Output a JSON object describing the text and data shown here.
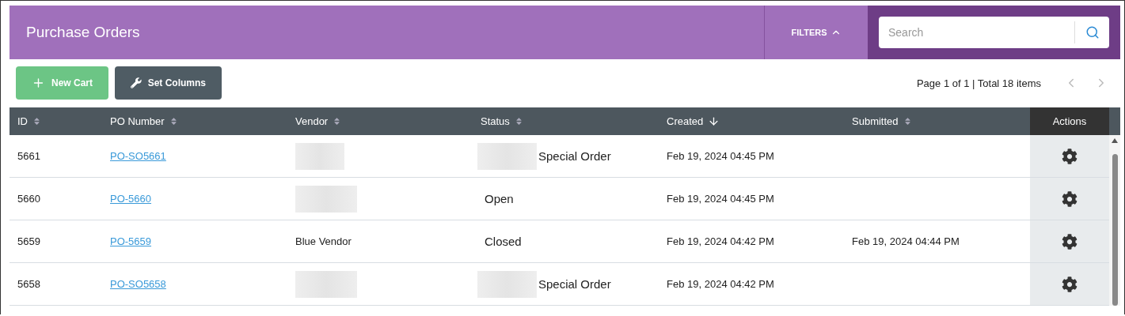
{
  "header": {
    "title": "Purchase Orders",
    "filters": {
      "label": "FILTERS",
      "expanded": true
    },
    "search": {
      "placeholder": "Search"
    }
  },
  "toolbar": {
    "buttons": [
      {
        "label": "New Cart",
        "kind": "new"
      },
      {
        "label": "Set Columns",
        "kind": "columns"
      }
    ],
    "pagination": {
      "text": "Page 1 of 1 | Total 18 items",
      "prev_disabled": true,
      "next_disabled": true
    }
  },
  "table": {
    "columns": [
      {
        "label": "ID",
        "sortable": true,
        "sorted_desc": false
      },
      {
        "label": "PO Number",
        "sortable": true,
        "sorted_desc": false
      },
      {
        "label": "Vendor",
        "sortable": true,
        "sorted_desc": false
      },
      {
        "label": "Status",
        "sortable": true,
        "sorted_desc": false
      },
      {
        "label": "Created",
        "sortable": true,
        "sorted_desc": true
      },
      {
        "label": "Submitted",
        "sortable": true,
        "sorted_desc": false
      },
      {
        "label": "Actions",
        "kind": "actions"
      }
    ],
    "rows": [
      {
        "id": "5661",
        "po": "PO-SO5661",
        "vendor": {
          "redacted": true
        },
        "status": {
          "text": "Special Order",
          "redacted_prefix": true
        },
        "created": "Feb 19, 2024 04:45 PM"
      },
      {
        "id": "5660",
        "po": "PO-5660",
        "vendor": {
          "redacted": true
        },
        "status": {
          "text": "Open",
          "redacted_prefix": false
        },
        "created": "Feb 19, 2024 04:45 PM"
      },
      {
        "id": "5659",
        "po": "PO-5659",
        "vendor": {
          "text": "Blue Vendor",
          "redacted": false
        },
        "status": {
          "text": "Closed",
          "redacted_prefix": false
        },
        "created": "Feb 19, 2024 04:42 PM",
        "submitted": "Feb 19, 2024 04:44 PM"
      },
      {
        "id": "5658",
        "po": "PO-SO5658",
        "vendor": {
          "redacted": true
        },
        "status": {
          "text": "Special Order",
          "redacted_prefix": true
        },
        "created": "Feb 19, 2024 04:42 PM"
      }
    ]
  }
}
